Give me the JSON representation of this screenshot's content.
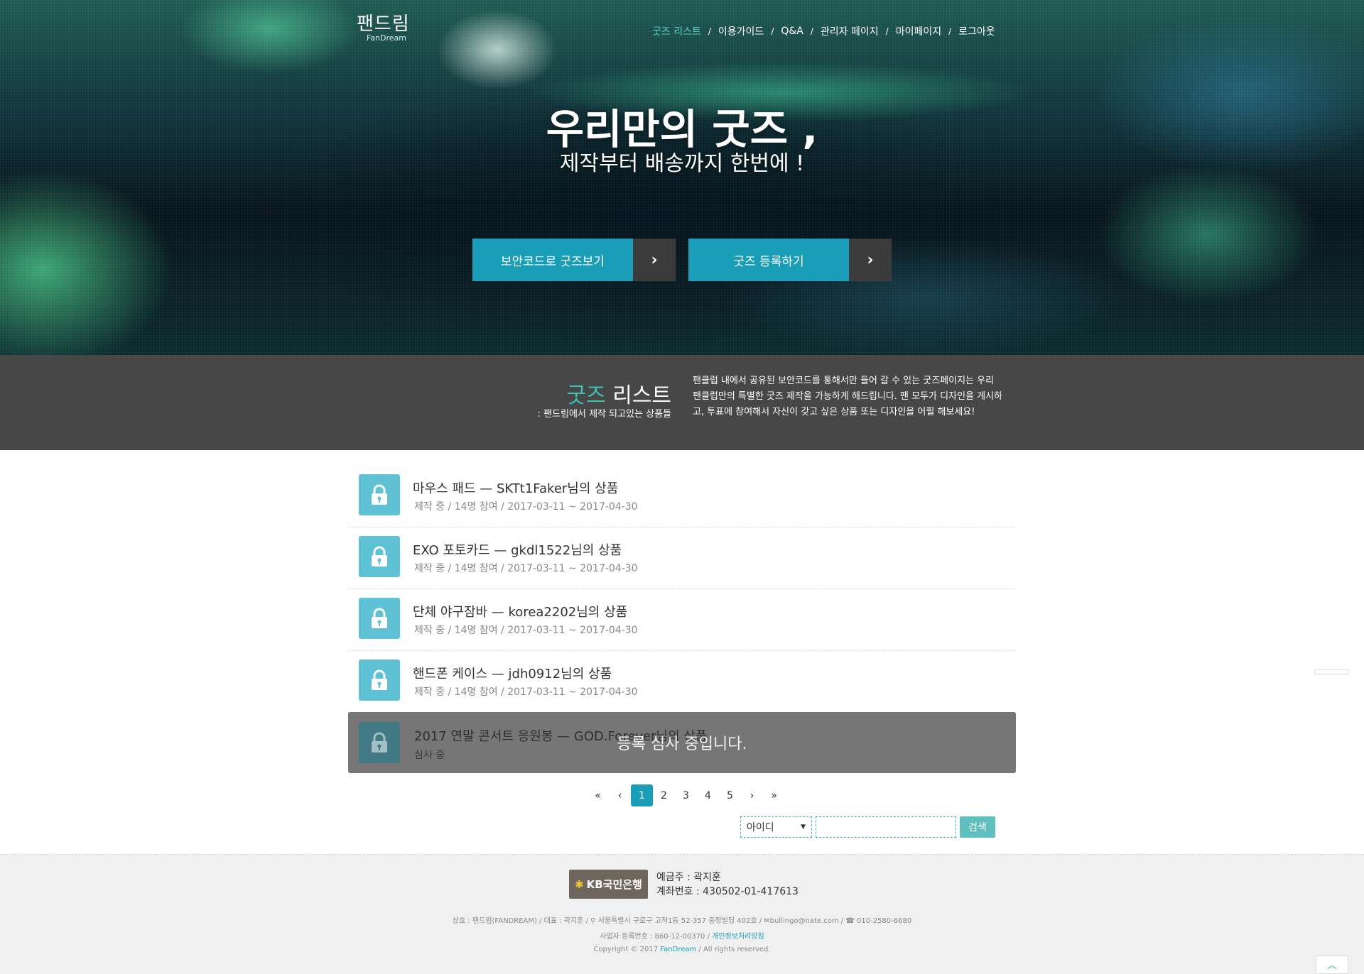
{
  "brand": {
    "logo_ko": "팬드림",
    "logo_en": "FanDream"
  },
  "nav": [
    {
      "label": "굿즈 리스트",
      "active": true
    },
    {
      "label": "이용가이드"
    },
    {
      "label": "Q&A"
    },
    {
      "label": "관리자 페이지"
    },
    {
      "label": "마이페이지"
    },
    {
      "label": "로그아웃"
    }
  ],
  "hero": {
    "title": "우리만의 굿즈 ,",
    "subtitle": "제작부터 배송까지 한번에 !",
    "cta_primary": "보안코드로 굿즈보기",
    "cta_secondary": "굿즈 등록하기"
  },
  "section": {
    "title_accent": "굿즈",
    "title_rest": " 리스트",
    "caption": ": 팬드림에서 제작 되고있는 상품들",
    "description": "팬클럽 내에서 공유된 보안코드를 통해서만 들어 갈 수 있는 굿즈페이지는 우리 팬클럽만의 특별한 굿즈 제작을 가능하게 해드립니다. 팬 모두가 디자인을 게시하고, 투표에 참여해서 자신이 갖고 싶은 상품 또는 디자인을 어필 해보세요!"
  },
  "goods": [
    {
      "name": "마우스 패드 — SKTt1Faker님의 상품",
      "meta": "제작 중 / 14명 참여 / 2017-03-11 ~ 2017-04-30"
    },
    {
      "name": "EXO 포토카드 — gkdl1522님의 상품",
      "meta": "제작 중 / 14명 참여 / 2017-03-11 ~ 2017-04-30"
    },
    {
      "name": "단체 야구잠바 — korea2202님의 상품",
      "meta": "제작 중 / 14명 참여 / 2017-03-11 ~ 2017-04-30"
    },
    {
      "name": "핸드폰 케이스 — jdh0912님의 상품",
      "meta": "제작 중 / 14명 참여 / 2017-03-11 ~ 2017-04-30"
    }
  ],
  "review_item": {
    "name": "2017 연말 콘서트 응원봉 — GOD.Forever님의 상품",
    "meta": "심사 중",
    "overlay": "등록 심사 중입니다."
  },
  "pagination": {
    "pages": [
      "1",
      "2",
      "3",
      "4",
      "5"
    ],
    "current": "1",
    "first": "«",
    "prev": "‹",
    "next": "›",
    "last": "»"
  },
  "search": {
    "field_selected": "아이디",
    "query": "",
    "button": "검색"
  },
  "footer": {
    "bank_logo": "KB국민은행",
    "account_holder": "예금주 : 곽지훈",
    "account_number": "계좌번호 : 430502-01-417613",
    "company": "상호 : 팬드림(FANDREAM)",
    "ceo": "대표 : 곽지훈",
    "address": "서울특별시 구로구 고척1동 52-357 중정빌딩 402호",
    "email": "bullingo@nate.com",
    "phone": "010-2580-6680",
    "biz_number": "사업자 등록번호 : 860-12-00370",
    "privacy_link": "개인정보처리방침",
    "copyright_pre": "Copyright © 2017 ",
    "copyright_brand": "FanDream",
    "copyright_post": " / All rights reserved."
  },
  "colors": {
    "accent": "#1a9db7",
    "teal": "#3fc2b3",
    "dark": "#474747"
  }
}
